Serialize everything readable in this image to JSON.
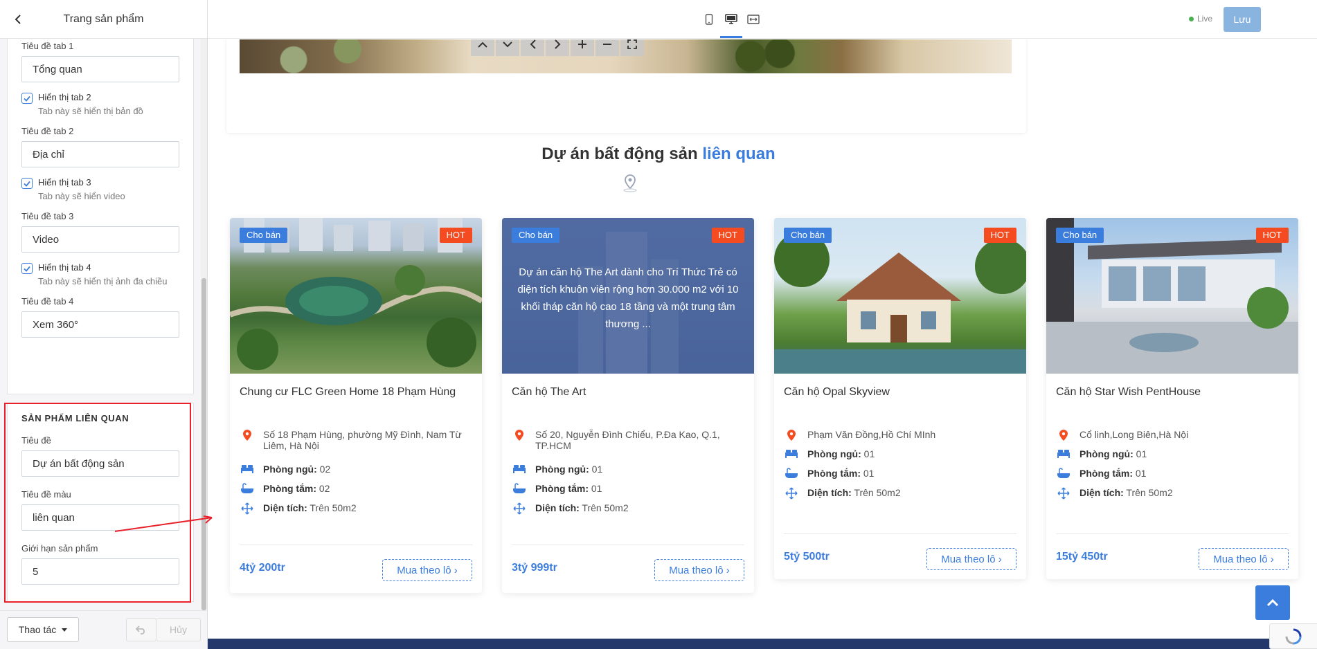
{
  "sidebar": {
    "title": "Trang sản phẩm",
    "fields": {
      "tab1_label": "Tiêu đề tab 1",
      "tab1_value": "Tổng quan",
      "show_tab2_label": "Hiển thị tab 2",
      "show_tab2_hint": "Tab này sẽ hiển thị bản đồ",
      "tab2_label": "Tiêu đề tab 2",
      "tab2_value": "Địa chỉ",
      "show_tab3_label": "Hiển thị tab 3",
      "show_tab3_hint": "Tab này sẽ hiển video",
      "tab3_label": "Tiêu đề tab 3",
      "tab3_value": "Video",
      "show_tab4_label": "Hiển thị tab 4",
      "show_tab4_hint": "Tab này sẽ hiển thị ảnh đa chiều",
      "tab4_label": "Tiêu đề tab 4",
      "tab4_value": "Xem 360°"
    },
    "related": {
      "heading": "SẢN PHẨM LIÊN QUAN",
      "title_label": "Tiêu đề",
      "title_value": "Dự án bất động sản",
      "color_title_label": "Tiêu đề màu",
      "color_title_value": "liên quan",
      "limit_label": "Giới hạn sản phẩm",
      "limit_value": "5"
    },
    "footer": {
      "actions_label": "Thao tác",
      "cancel_label": "Hủy"
    }
  },
  "topbar": {
    "live_label": "Live",
    "save_label": "Lưu"
  },
  "section": {
    "title": "Dự án bất động sản",
    "title_highlight": "liên quan"
  },
  "cards": [
    {
      "status": "Cho bán",
      "badge": "HOT",
      "name": "Chung cư FLC Green Home 18 Phạm Hùng",
      "address": "Số 18 Phạm Hùng, phường Mỹ Đình, Nam Từ Liêm, Hà Nội",
      "bedrooms_label": "Phòng ngủ:",
      "bedrooms": "02",
      "bathrooms_label": "Phòng tắm:",
      "bathrooms": "02",
      "area_label": "Diện tích:",
      "area": "Trên 50m2",
      "price": "4tỷ 200tr",
      "cta": "Mua theo lô ›"
    },
    {
      "status": "Cho bán",
      "badge": "HOT",
      "overlay": "Dự án căn hộ The Art dành cho Trí Thức Trẻ có diện tích khuôn viên rộng hơn 30.000 m2 với 10 khối tháp căn hộ cao 18 tầng và một trung tâm thương ...",
      "name": "Căn hộ The Art",
      "address": "Số 20, Nguyễn Đình Chiểu, P.Đa Kao, Q.1, TP.HCM",
      "bedrooms_label": "Phòng ngủ:",
      "bedrooms": "01",
      "bathrooms_label": "Phòng tắm:",
      "bathrooms": "01",
      "area_label": "Diện tích:",
      "area": "Trên 50m2",
      "price": "3tỷ 999tr",
      "cta": "Mua theo lô ›"
    },
    {
      "status": "Cho bán",
      "badge": "HOT",
      "name": "Căn hộ Opal Skyview",
      "address": "Phạm Văn Đồng,Hồ Chí MInh",
      "bedrooms_label": "Phòng ngủ:",
      "bedrooms": "01",
      "bathrooms_label": "Phòng tắm:",
      "bathrooms": "01",
      "area_label": "Diện tích:",
      "area": "Trên 50m2",
      "price": "5tỷ 500tr",
      "cta": "Mua theo lô ›"
    },
    {
      "status": "Cho bán",
      "badge": "HOT",
      "name": "Căn hộ Star Wish PentHouse",
      "address": "Cổ linh,Long Biên,Hà Nội",
      "bedrooms_label": "Phòng ngủ:",
      "bedrooms": "01",
      "bathrooms_label": "Phòng tắm:",
      "bathrooms": "01",
      "area_label": "Diện tích:",
      "area": "Trên 50m2",
      "price": "15tỷ 450tr",
      "cta": "Mua theo lô ›"
    }
  ],
  "colors": {
    "accent": "#3b7ddd",
    "hot": "#f44b21",
    "highlight_box": "#e8212a",
    "footer": "#24386b"
  }
}
